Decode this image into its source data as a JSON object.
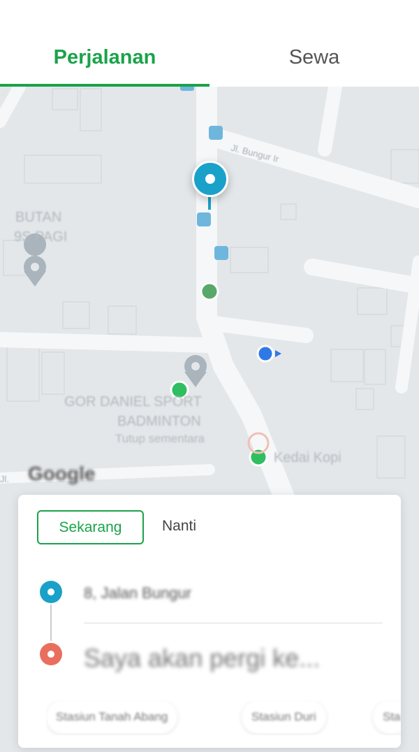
{
  "tabs": [
    {
      "label": "Perjalanan",
      "active": true
    },
    {
      "label": "Sewa",
      "active": false
    }
  ],
  "map": {
    "poi_labels": [
      "BUTAN",
      "9S PAGI",
      "GOR DANIEL SPORT",
      "BADMINTON",
      "Tutup sementara",
      "Kedai Kopi"
    ],
    "street_labels": [
      "Jl. Bungur Ir",
      "Jl."
    ],
    "attribution": "Google"
  },
  "booking": {
    "time_now": "Sekarang",
    "time_later": "Nanti",
    "origin": "8, Jalan Bungur",
    "destination_placeholder": "Saya akan pergi ke...",
    "chips": [
      "Stasiun Tanah Abang",
      "Stasiun Duri",
      "Sta"
    ]
  },
  "colors": {
    "accent": "#1aa34a",
    "pin": "#1aa1c9",
    "destination": "#e96e5e"
  }
}
